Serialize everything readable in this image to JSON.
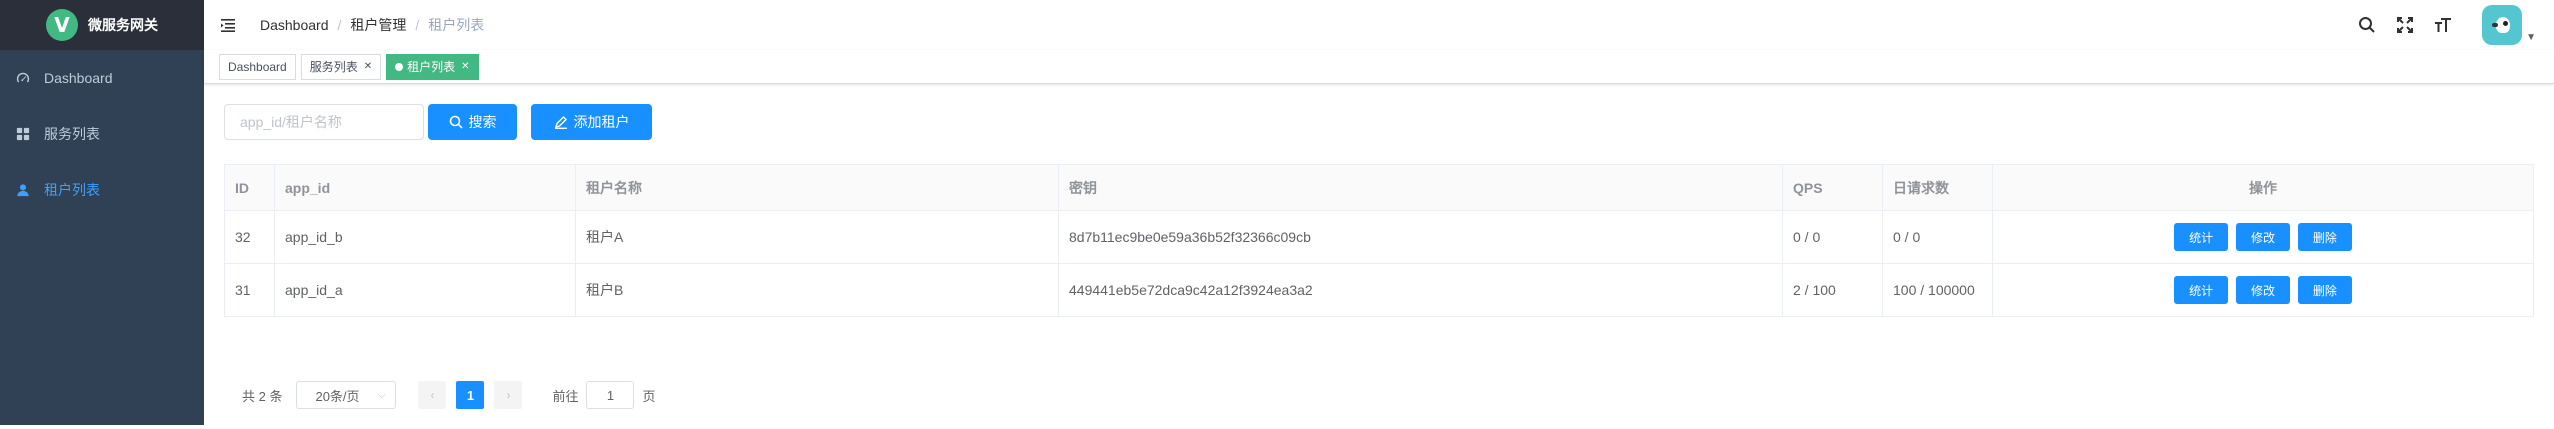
{
  "sidebar": {
    "logo_letter": "V",
    "logo_title": "微服务网关",
    "items": [
      {
        "label": "Dashboard",
        "icon": "dashboard-icon",
        "active": false
      },
      {
        "label": "服务列表",
        "icon": "grid-icon",
        "active": false
      },
      {
        "label": "租户列表",
        "icon": "user-icon",
        "active": true
      }
    ]
  },
  "navbar": {
    "breadcrumb": [
      "Dashboard",
      "租户管理",
      "租户列表"
    ],
    "separator": "/"
  },
  "tags": [
    {
      "label": "Dashboard",
      "active": false,
      "closable": false
    },
    {
      "label": "服务列表",
      "active": false,
      "closable": true
    },
    {
      "label": "租户列表",
      "active": true,
      "closable": true
    }
  ],
  "filter": {
    "placeholder": "app_id/租户名称",
    "value": "",
    "search_label": "搜索",
    "add_label": "添加租户"
  },
  "table": {
    "columns": [
      "ID",
      "app_id",
      "租户名称",
      "密钥",
      "QPS",
      "日请求数",
      "操作"
    ],
    "rows": [
      {
        "id": "32",
        "app_id": "app_id_b",
        "name": "租户A",
        "secret": "8d7b11ec9be0e59a36b52f32366c09cb",
        "qps": "0 / 0",
        "daily": "0 / 0"
      },
      {
        "id": "31",
        "app_id": "app_id_a",
        "name": "租户B",
        "secret": "449441eb5e72dca9c42a12f3924ea3a2",
        "qps": "2 / 100",
        "daily": "100 / 100000"
      }
    ],
    "actions": [
      "统计",
      "修改",
      "删除"
    ]
  },
  "pagination": {
    "total_text": "共 2 条",
    "page_size": "20条/页",
    "current_page": "1",
    "goto_label": "前往",
    "goto_value": "1",
    "page_suffix": "页"
  },
  "colors": {
    "sidebar_bg": "#304156",
    "primary": "#1890ff",
    "active_tag": "#42b983"
  }
}
